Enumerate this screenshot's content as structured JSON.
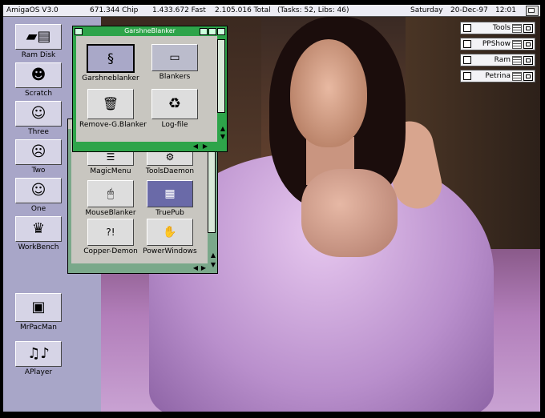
{
  "titlebar": {
    "os": "AmigaOS V3.0",
    "chip": "671.344 Chip",
    "fast": "1.433.672 Fast",
    "total": "2.105.016 Total",
    "tasks": "(Tasks: 52, Libs: 46)",
    "day": "Saturday",
    "date": "20-Dec-97",
    "time": "12:01"
  },
  "desktop_icons": [
    {
      "label": "Ram Disk",
      "icon": "ram-disk-icon"
    },
    {
      "label": "Scratch",
      "icon": "scratch-icon"
    },
    {
      "label": "Three",
      "icon": "three-icon"
    },
    {
      "label": "Two",
      "icon": "two-icon"
    },
    {
      "label": "One",
      "icon": "one-icon"
    },
    {
      "label": "WorkBench",
      "icon": "workbench-icon"
    },
    {
      "label": "MrPacMan",
      "icon": "floppy-icon"
    },
    {
      "label": "APlayer",
      "icon": "music-notes-icon"
    }
  ],
  "windows": {
    "garshne": {
      "title": "GarshneBlanker",
      "icons": [
        {
          "label": "Garshneblanker",
          "icon": "snake-icon"
        },
        {
          "label": "Blankers",
          "icon": "drawer-icon"
        },
        {
          "label": "Remove-G.Blanker",
          "icon": "trash-icon"
        },
        {
          "label": "Log-file",
          "icon": "recycle-icon"
        }
      ]
    },
    "tools": {
      "icons": [
        {
          "label": "MagicMenu",
          "icon": "magicmenu-icon"
        },
        {
          "label": "ToolsDaemon",
          "icon": "toolsdaemon-icon"
        },
        {
          "label": "MouseBlanker",
          "icon": "mouseblanker-icon"
        },
        {
          "label": "TruePub",
          "icon": "truepub-icon"
        },
        {
          "label": "Copper-Demon",
          "icon": "copper-demon-icon"
        },
        {
          "label": "PowerWindows",
          "icon": "powerwindows-icon"
        }
      ]
    }
  },
  "dock_windows": [
    {
      "label": "Tools"
    },
    {
      "label": "PPShow"
    },
    {
      "label": "Ram"
    },
    {
      "label": "Petrina"
    }
  ],
  "colors": {
    "window_active": "#2ea44a",
    "window_inactive": "#7aa88a",
    "backdrop": "#7e7aa8"
  }
}
